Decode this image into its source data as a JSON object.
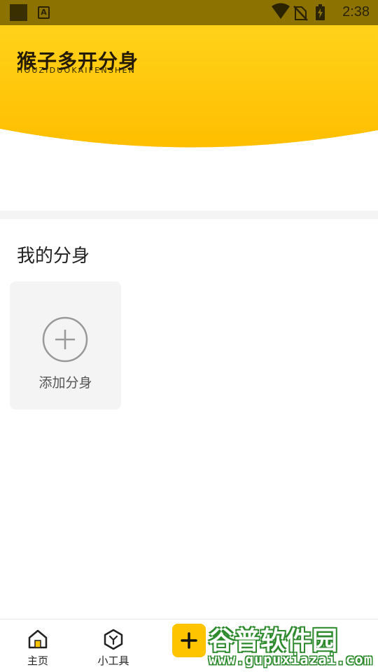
{
  "status_bar": {
    "time": "2:38",
    "icons": [
      "notification-square-icon",
      "a-notification-icon",
      "wifi-icon",
      "no-sim-icon",
      "battery-charging-icon"
    ]
  },
  "header": {
    "title": "猴子多开分身",
    "subtitle": "HOUZIDUOKAIFENSHEN",
    "colors": {
      "top": "#ffd21a",
      "bottom": "#ffbe00"
    }
  },
  "section": {
    "title": "我的分身",
    "add_card_label": "添加分身"
  },
  "bottom_nav": {
    "items": [
      {
        "label": "主页",
        "icon": "home-icon",
        "active": true
      },
      {
        "label": "小工具",
        "icon": "tool-hexagon-icon",
        "active": false
      }
    ],
    "fab_icon": "plus-icon",
    "accent": "#ffc400"
  },
  "watermark": {
    "main_text": "谷普软件园",
    "url_text": "www.gupuxiazai.com"
  }
}
